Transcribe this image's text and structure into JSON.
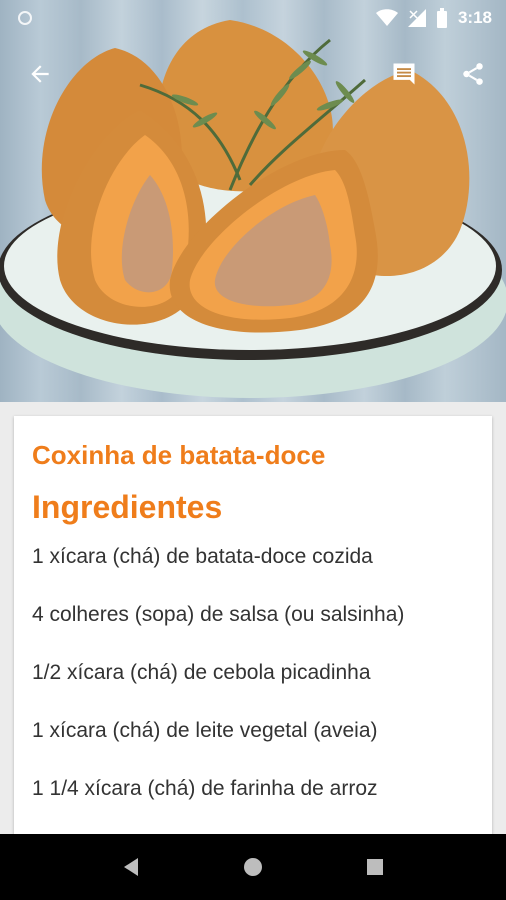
{
  "status_bar": {
    "time": "3:18"
  },
  "toolbar": {
    "back_icon": "arrow-back-icon",
    "comment_icon": "comment-icon",
    "share_icon": "share-icon"
  },
  "hero": {
    "image": "coxinha-photo"
  },
  "recipe": {
    "title": "Coxinha de batata-doce",
    "section_title": "Ingredientes",
    "ingredients": [
      "1 xícara (chá) de batata-doce cozida",
      "4 colheres (sopa) de salsa (ou salsinha)",
      "1/2 xícara (chá) de cebola picadinha",
      "1 xícara (chá) de leite vegetal (aveia)",
      "1 1/4 xícara (chá) de farinha de arroz"
    ]
  },
  "colors": {
    "accent": "#ef7d1b",
    "text": "#333333",
    "nav_bar": "#000000"
  }
}
